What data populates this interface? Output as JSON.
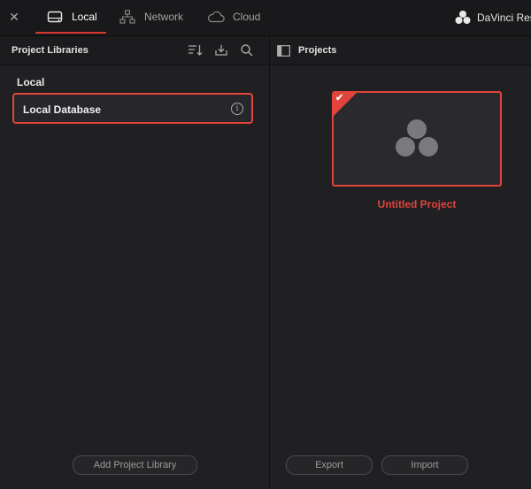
{
  "topbar": {
    "tabs": [
      {
        "label": "Local",
        "icon": "hard-drive-icon",
        "active": true
      },
      {
        "label": "Network",
        "icon": "network-icon",
        "active": false
      },
      {
        "label": "Cloud",
        "icon": "cloud-icon",
        "active": false
      }
    ],
    "brand": "DaVinci Res",
    "accent": "#d83a32"
  },
  "left_panel": {
    "title": "Project Libraries",
    "group_label": "Local",
    "items": [
      {
        "label": "Local Database",
        "selected": true
      }
    ],
    "add_button": "Add Project Library"
  },
  "right_panel": {
    "title": "Projects",
    "projects": [
      {
        "name": "Untitled Project",
        "selected": true
      }
    ],
    "export_button": "Export",
    "import_button": "Import"
  }
}
